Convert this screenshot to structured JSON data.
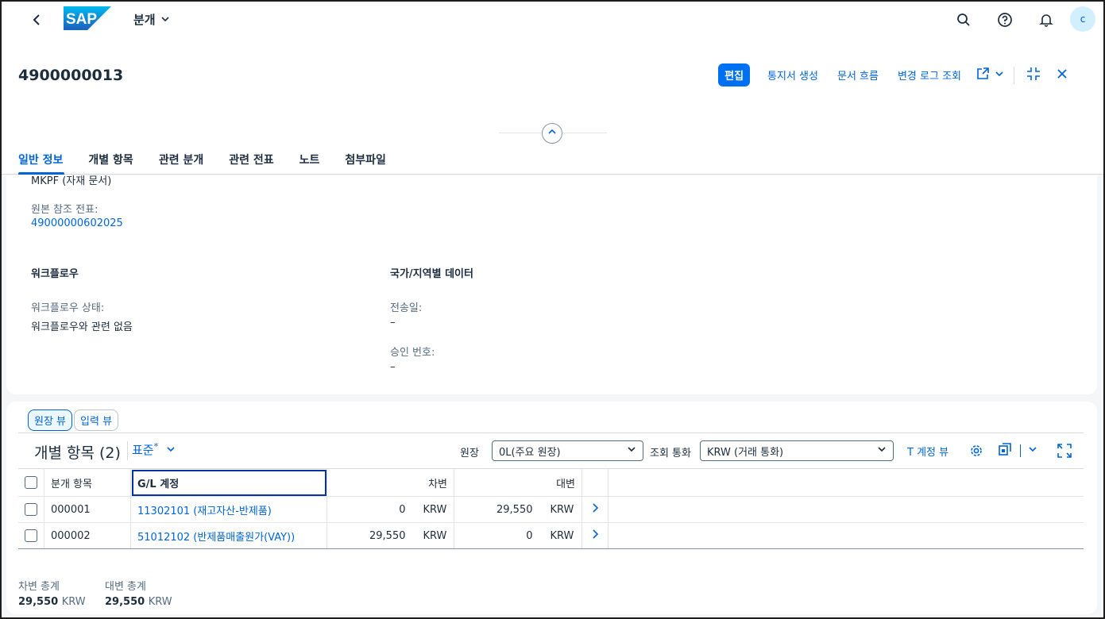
{
  "shell": {
    "logo_text": "SAP",
    "app_title": "분개",
    "avatar_initial": "c"
  },
  "header": {
    "document_number": "4900000013",
    "actions": {
      "edit": "편집",
      "create_notice": "통지서 생성",
      "document_flow": "문서 흐름",
      "change_log": "변경 로그 조회"
    },
    "tabs": [
      "일반 정보",
      "개별 항목",
      "관련 분개",
      "관련 전표",
      "노트",
      "첨부파일"
    ]
  },
  "general": {
    "partial_value": "MKPF (자재 문서)",
    "orig_ref_label": "원본 참조 전표:",
    "orig_ref_value": "49000000602025",
    "workflow_title": "워크플로우",
    "workflow_status_label": "워크플로우 상태:",
    "workflow_status_value": "워크플로우와 관련 없음",
    "country_title": "국가/지역별 데이터",
    "transfer_date_label": "전송일:",
    "transfer_date_value": "–",
    "approval_no_label": "승인 번호:",
    "approval_no_value": "–"
  },
  "line_items": {
    "view_ledger": "원장 뷰",
    "view_entry": "입력 뷰",
    "title": "개별 항목 (2)",
    "variant": "표준",
    "variant_mark": "*",
    "ledger_label": "원장",
    "ledger_value": "0L(주요 원장)",
    "currency_label": "조회 통화",
    "currency_value": "KRW (거래 통화)",
    "t_account_view": "T 계정 뷰",
    "columns": {
      "item": "분개 항목",
      "gl_account": "G/L 계정",
      "debit": "차변",
      "credit": "대변"
    },
    "rows": [
      {
        "item": "000001",
        "gl": "11302101 (재고자산-반제품)",
        "debit": "0",
        "debit_cur": "KRW",
        "credit": "29,550",
        "credit_cur": "KRW"
      },
      {
        "item": "000002",
        "gl": "51012102 (반제품매출원가(VAY))",
        "debit": "29,550",
        "debit_cur": "KRW",
        "credit": "0",
        "credit_cur": "KRW"
      }
    ],
    "total_debit_label": "차변 총계",
    "total_debit_value": "29,550",
    "total_debit_cur": "KRW",
    "total_credit_label": "대변 총계",
    "total_credit_value": "29,550",
    "total_credit_cur": "KRW"
  },
  "colors": {
    "brand": "#0070f2",
    "link": "#0064d9"
  }
}
